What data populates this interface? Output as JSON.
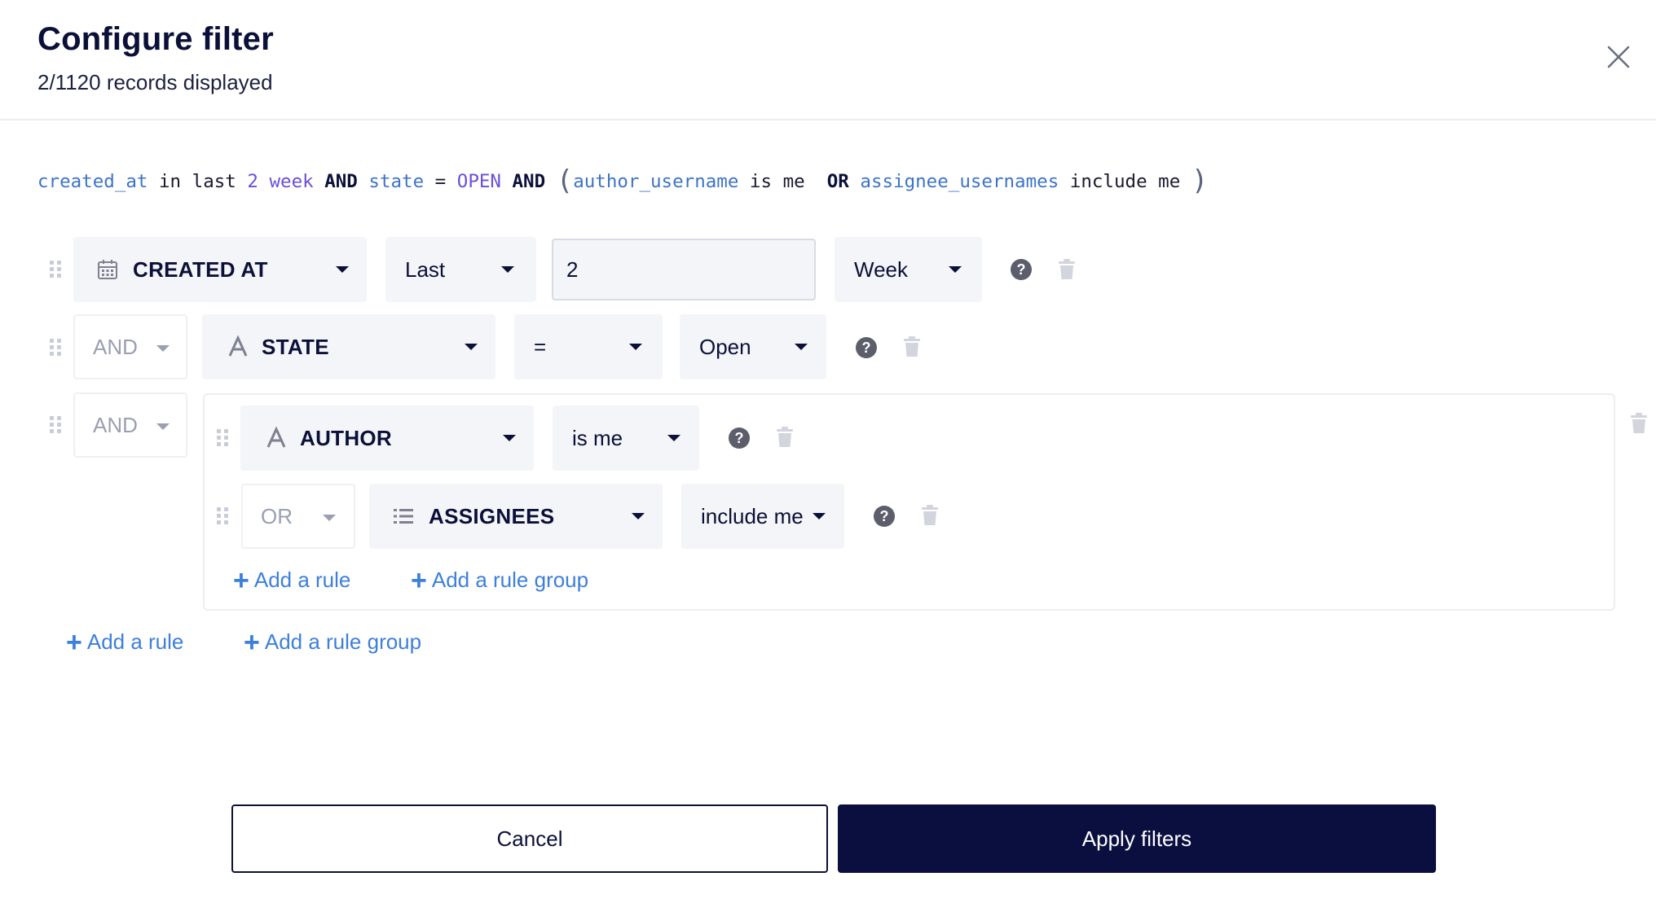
{
  "header": {
    "title": "Configure filter",
    "subtitle": "2/1120 records displayed"
  },
  "query": {
    "created_at": "created_at",
    "in_last": " in last ",
    "num": "2",
    "space": " ",
    "week": "week",
    "and1": " AND ",
    "state": "state",
    "eq": " = ",
    "open": "OPEN",
    "and2": " AND ",
    "lparen": "(",
    "author": "author_username",
    "is_me": " is me  ",
    "or": "OR",
    "assignees": " assignee_usernames",
    "include_me": " include me ",
    "rparen": ")"
  },
  "rule1": {
    "field": "CREATED AT",
    "field_icon": "calendar-icon",
    "operator": "Last",
    "value": "2",
    "unit": "Week"
  },
  "rule2": {
    "combinator": "AND",
    "field": "STATE",
    "field_icon": "text-icon",
    "operator": "=",
    "value": "Open"
  },
  "group": {
    "combinator": "AND",
    "rule1": {
      "field": "AUTHOR",
      "field_icon": "text-icon",
      "operator": "is me"
    },
    "rule2": {
      "combinator": "OR",
      "field": "ASSIGNEES",
      "field_icon": "list-icon",
      "operator": "include me"
    },
    "add_rule": "Add a rule",
    "add_rule_group": "Add a rule group"
  },
  "root_actions": {
    "add_rule": "Add a rule",
    "add_rule_group": "Add a rule group"
  },
  "footer": {
    "cancel": "Cancel",
    "apply": "Apply filters"
  },
  "colors": {
    "primary": "#0b0f3f",
    "link": "#3d7fdc",
    "query_field": "#3d74c8",
    "query_value": "#6b4fd8"
  }
}
